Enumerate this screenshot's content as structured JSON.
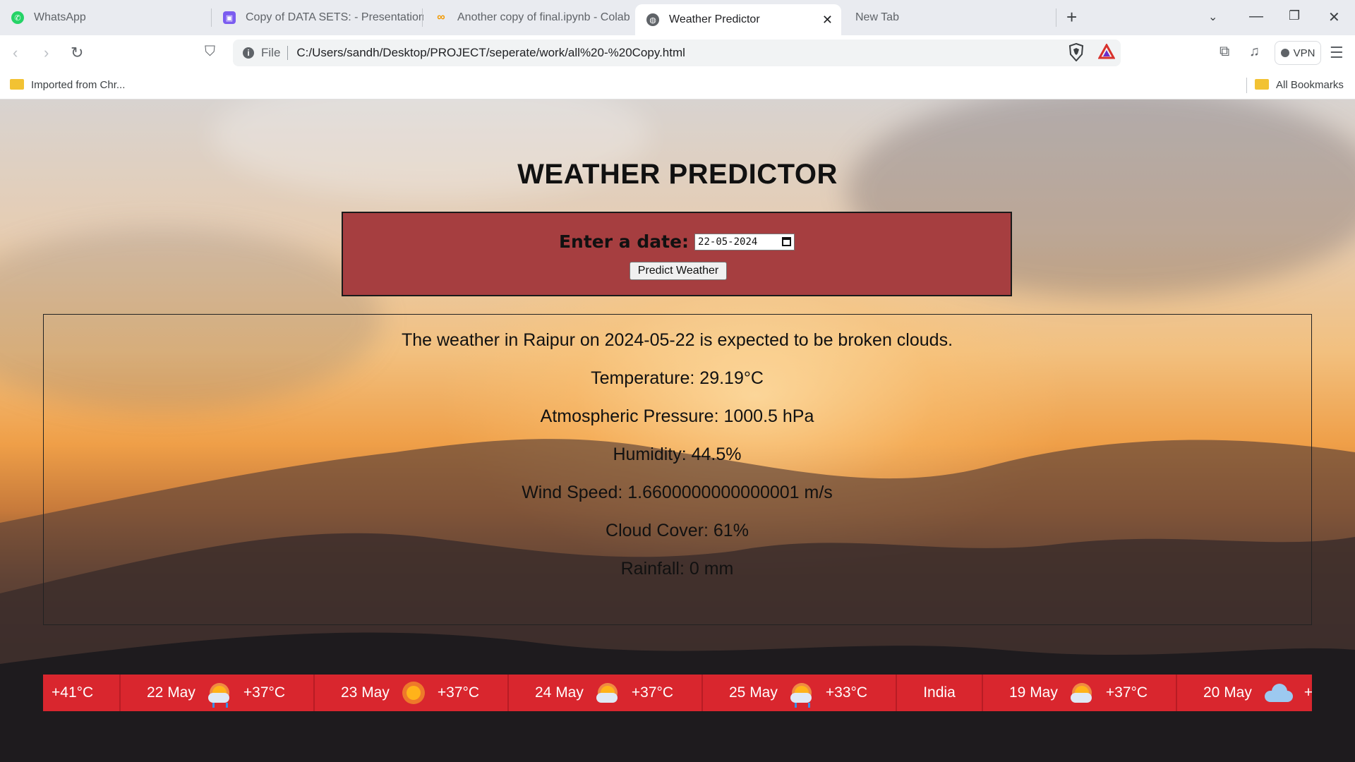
{
  "browser": {
    "tabs": [
      {
        "title": "WhatsApp",
        "icon": "whatsapp-icon",
        "active": false
      },
      {
        "title": "Copy of DATA SETS: - Presentation",
        "icon": "slides-icon",
        "active": false
      },
      {
        "title": "Another copy of final.ipynb - Colab",
        "icon": "colab-icon",
        "active": false
      },
      {
        "title": "Weather Predictor",
        "icon": "globe-icon",
        "active": true
      },
      {
        "title": "New Tab",
        "icon": "",
        "active": false
      }
    ],
    "address": {
      "scheme": "File",
      "url": "C:/Users/sandh/Desktop/PROJECT/seperate/work/all%20-%20Copy.html"
    },
    "vpn_label": "VPN",
    "bookmarks": {
      "imported": "Imported from Chr...",
      "all": "All Bookmarks"
    }
  },
  "page": {
    "title": "WEATHER PREDICTOR",
    "form": {
      "label": "Enter a date:",
      "date_value": "22-05-2024",
      "button": "Predict Weather"
    },
    "result": {
      "summary": "The weather in Raipur on 2024-05-22 is expected to be broken clouds.",
      "temperature": "Temperature: 29.19°C",
      "pressure": "Atmospheric Pressure: 1000.5 hPa",
      "humidity": "Humidity: 44.5%",
      "wind": "Wind Speed: 1.6600000000000001 m/s",
      "cloud": "Cloud Cover: 61%",
      "rainfall": "Rainfall: 0 mm"
    },
    "ticker": [
      {
        "temp": "+41°C"
      },
      {
        "date": "22 May",
        "icon": "sun-rain-icon",
        "temp": "+37°C"
      },
      {
        "date": "23 May",
        "icon": "sun-icon",
        "temp": "+37°C"
      },
      {
        "date": "24 May",
        "icon": "sun-cloud-icon",
        "temp": "+37°C"
      },
      {
        "date": "25 May",
        "icon": "sun-rain-icon",
        "temp": "+33°C"
      },
      {
        "location": "India"
      },
      {
        "date": "19 May",
        "icon": "sun-cloud-icon",
        "temp": "+37°C"
      },
      {
        "date": "20 May",
        "icon": "cloud-icon",
        "temp": "+"
      }
    ]
  }
}
